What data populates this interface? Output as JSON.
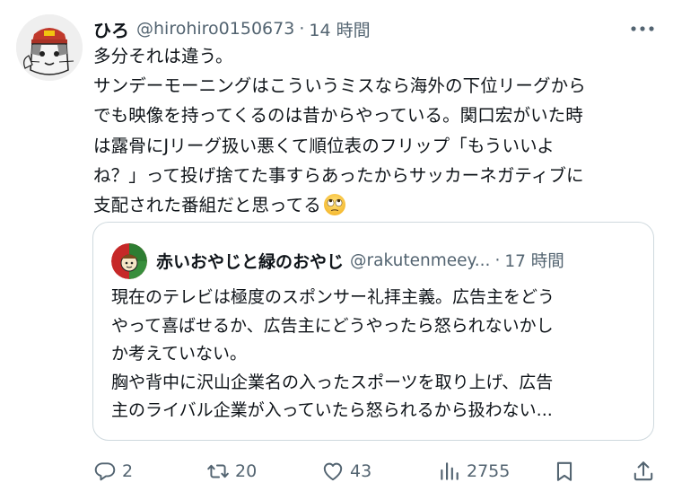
{
  "tweet": {
    "author": {
      "display_name": "ひろ",
      "handle": "@hirohiro0150673",
      "separator": "·",
      "time": "14 時間"
    },
    "text_lines": [
      "多分それは違う。",
      "サンデーモーニングはこういうミスなら海外の下位リーグから",
      "でも映像を持ってくるのは昔からやっている。関口宏がいた時",
      "は露骨にJリーグ扱い悪くて順位表のフリップ「もういいよ",
      "ね？」って投げ捨てた事すらあったからサッカーネガティブに",
      "支配された番組だと思ってる"
    ],
    "trailing_emoji": "face-with-rolling-eyes"
  },
  "quote": {
    "author": {
      "display_name": "赤いおやじと緑のおやじ",
      "handle": "@rakutenmeey...",
      "separator": "·",
      "time": "17 時間"
    },
    "text_lines": [
      "現在のテレビは極度のスポンサー礼拝主義。広告主をどう",
      "やって喜ばせるか、広告主にどうやったら怒られないかし",
      "か考えていない。",
      "胸や背中に沢山企業名の入ったスポーツを取り上げ、広告",
      "主のライバル企業が入っていたら怒られるから扱わない..."
    ]
  },
  "actions": {
    "reply_count": "2",
    "retweet_count": "20",
    "like_count": "43",
    "view_count": "2755"
  },
  "icons": {
    "more": "more-horizontal-icon",
    "reply": "reply-icon",
    "retweet": "retweet-icon",
    "like": "heart-icon",
    "views": "views-chart-icon",
    "bookmark": "bookmark-icon",
    "share": "share-icon"
  },
  "colors": {
    "text_primary": "#0f1419",
    "text_secondary": "#536471",
    "border": "#cfd9de"
  }
}
